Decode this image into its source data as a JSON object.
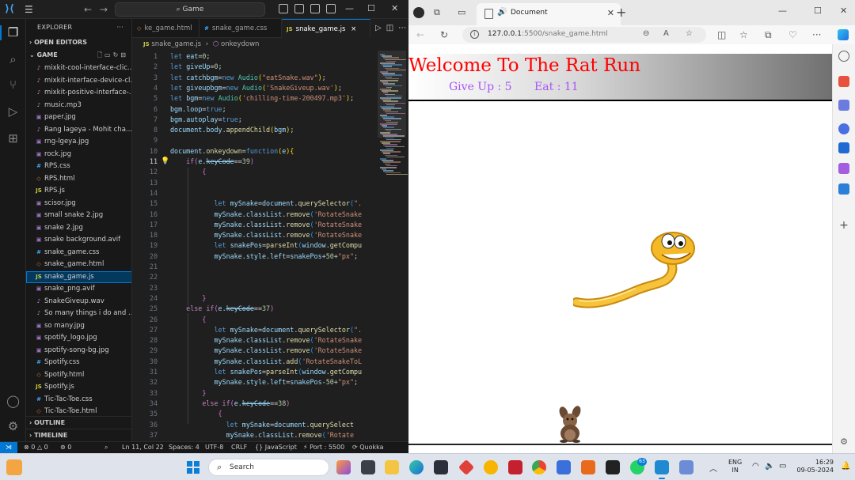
{
  "vscode": {
    "search_text": "Game",
    "explorer_title": "EXPLORER",
    "open_editors": "OPEN EDITORS",
    "folder": "GAME",
    "outline": "OUTLINE",
    "timeline": "TIMELINE",
    "files": [
      {
        "name": "mixkit-cool-interface-clic...",
        "type": "music",
        "icon": "♪"
      },
      {
        "name": "mixkit-interface-device-cl...",
        "type": "music",
        "icon": "♪"
      },
      {
        "name": "mixkit-positive-interface-...",
        "type": "music",
        "icon": "♪"
      },
      {
        "name": "music.mp3",
        "type": "music",
        "icon": "♪"
      },
      {
        "name": "paper.jpg",
        "type": "img",
        "icon": "▣"
      },
      {
        "name": "Rang lageya - Mohit cha...",
        "type": "music",
        "icon": "♪"
      },
      {
        "name": "rng-lgeya.jpg",
        "type": "img",
        "icon": "▣"
      },
      {
        "name": "rock.jpg",
        "type": "img",
        "icon": "▣"
      },
      {
        "name": "RPS.css",
        "type": "css",
        "icon": "#"
      },
      {
        "name": "RPS.html",
        "type": "html",
        "icon": "◇"
      },
      {
        "name": "RPS.js",
        "type": "js",
        "icon": "JS"
      },
      {
        "name": "scisor.jpg",
        "type": "img",
        "icon": "▣"
      },
      {
        "name": "small snake 2.jpg",
        "type": "img",
        "icon": "▣"
      },
      {
        "name": "snake 2.jpg",
        "type": "img",
        "icon": "▣"
      },
      {
        "name": "snake background.avif",
        "type": "img",
        "icon": "▣"
      },
      {
        "name": "snake_game.css",
        "type": "css",
        "icon": "#"
      },
      {
        "name": "snake_game.html",
        "type": "html",
        "icon": "◇"
      },
      {
        "name": "snake_game.js",
        "type": "js",
        "icon": "JS",
        "selected": true
      },
      {
        "name": "snake_png.avif",
        "type": "img",
        "icon": "▣"
      },
      {
        "name": "SnakeGiveup.wav",
        "type": "music",
        "icon": "♪"
      },
      {
        "name": "So many things i do and ...",
        "type": "music",
        "icon": "♪"
      },
      {
        "name": "so many.jpg",
        "type": "img",
        "icon": "▣"
      },
      {
        "name": "spotify_logo.jpg",
        "type": "img",
        "icon": "▣"
      },
      {
        "name": "spotify-song-bg.jpg",
        "type": "img",
        "icon": "▣"
      },
      {
        "name": "Spotify.css",
        "type": "css",
        "icon": "#"
      },
      {
        "name": "Spotify.html",
        "type": "html",
        "icon": "◇"
      },
      {
        "name": "Spotify.js",
        "type": "js",
        "icon": "JS"
      },
      {
        "name": "Tic-Tac-Toe.css",
        "type": "css",
        "icon": "#"
      },
      {
        "name": "Tic-Tac-Toe.html",
        "type": "html",
        "icon": "◇"
      }
    ],
    "tabs": [
      {
        "label": "ke_game.html",
        "icon": "◇",
        "type": "html"
      },
      {
        "label": "snake_game.css",
        "icon": "#",
        "type": "css"
      },
      {
        "label": "snake_game.js",
        "icon": "JS",
        "type": "js",
        "active": true,
        "close": "×"
      }
    ],
    "breadcrumb": {
      "file": "snake_game.js",
      "symbol": "onkeydown"
    },
    "status": {
      "errors": "0",
      "warnings": "0",
      "ports": "0",
      "position": "Ln 11, Col 22",
      "spaces": "Spaces: 4",
      "encoding": "UTF-8",
      "eol": "CRLF",
      "language": "{} JavaScript",
      "port": "Port : 5500",
      "quokka": "Quokka"
    }
  },
  "browser": {
    "tab_title": "Document",
    "url_host": "127.0.0.1",
    "url_path": ":5500/snake_game.html",
    "game": {
      "title": "Welcome To The Rat Run",
      "give_up": "Give Up : 5",
      "eat": "Eat : 11"
    }
  },
  "taskbar": {
    "search": "Search",
    "lang_top": "ENG",
    "lang_bottom": "IN",
    "time": "16:29",
    "date": "09-05-2024",
    "badge": "63"
  }
}
